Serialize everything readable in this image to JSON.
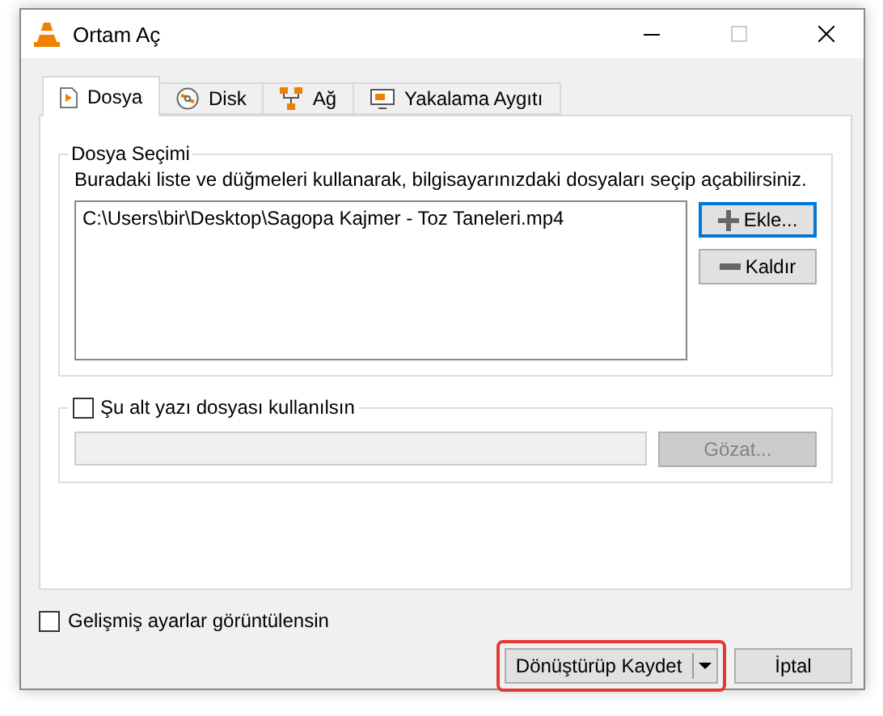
{
  "window": {
    "title": "Ortam Aç"
  },
  "tabs": [
    {
      "label": "Dosya",
      "kind": "file",
      "selected": true
    },
    {
      "label": "Disk",
      "kind": "disc",
      "selected": false
    },
    {
      "label": "Ağ",
      "kind": "network",
      "selected": false
    },
    {
      "label": "Yakalama Aygıtı",
      "kind": "capture",
      "selected": false
    }
  ],
  "file_group": {
    "title": "Dosya Seçimi",
    "description": "Buradaki liste ve düğmeleri kullanarak, bilgisayarınızdaki dosyaları seçip açabilirsiniz.",
    "files": [
      "C:\\Users\\bir\\Desktop\\Sagopa Kajmer - Toz Taneleri.mp4"
    ],
    "buttons": [
      {
        "label": "Ekle...",
        "kind": "add",
        "focused": true
      },
      {
        "label": "Kaldır",
        "kind": "remove",
        "focused": false
      }
    ]
  },
  "subtitle_group": {
    "label": "Şu alt yazı dosyası kullanılsın",
    "checked": false,
    "browse": {
      "label": "Gözat...",
      "disabled": true
    }
  },
  "advanced": {
    "label": "Gelişmiş ayarlar görüntülensin",
    "checked": false
  },
  "actions": [
    {
      "label": "Dönüştürüp Kaydet",
      "kind": "split",
      "highlighted": true
    },
    {
      "label": "İptal",
      "kind": "plain",
      "highlighted": false
    }
  ]
}
